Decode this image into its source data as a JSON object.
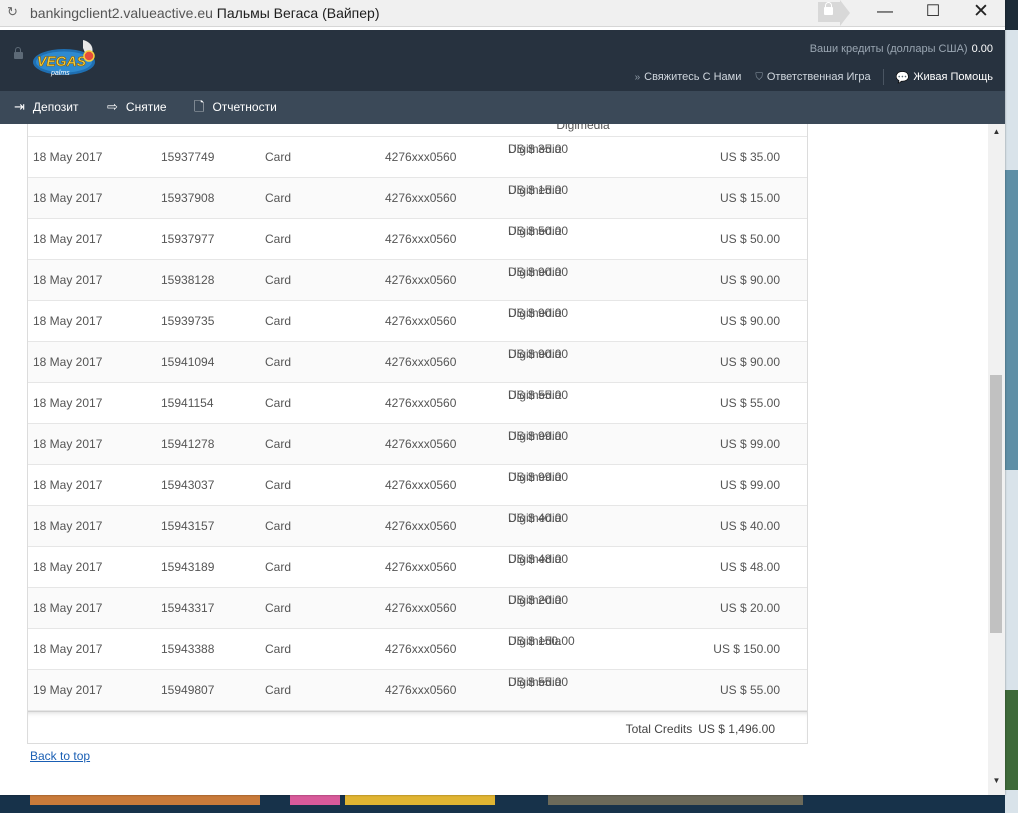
{
  "titlebar": {
    "url": "bankingclient2.valueactive.eu",
    "title": "Пальмы Вегаса (Вайпер)"
  },
  "header": {
    "credits_label": "Ваши кредиты (доллары США)",
    "credits_value": "0.00",
    "links": {
      "contact": "Свяжитесь С Нами",
      "responsible": "Ответственная Игра",
      "live_help": "Живая Помощь"
    }
  },
  "nav": {
    "deposit": "Депозит",
    "withdraw": "Снятие",
    "reports": "Отчетности"
  },
  "table": {
    "partial_row": {
      "method": "Digimedia"
    },
    "rows": [
      {
        "date": "18 May 2017",
        "id": "15937749",
        "type": "Card",
        "card": "4276xxx0560",
        "amount": "US $ 35.00",
        "method": "Digimedia",
        "credit": "US $ 35.00"
      },
      {
        "date": "18 May 2017",
        "id": "15937908",
        "type": "Card",
        "card": "4276xxx0560",
        "amount": "US $ 15.00",
        "method": "Digimedia",
        "credit": "US $ 15.00"
      },
      {
        "date": "18 May 2017",
        "id": "15937977",
        "type": "Card",
        "card": "4276xxx0560",
        "amount": "US $ 50.00",
        "method": "Digimedia",
        "credit": "US $ 50.00"
      },
      {
        "date": "18 May 2017",
        "id": "15938128",
        "type": "Card",
        "card": "4276xxx0560",
        "amount": "US $ 90.00",
        "method": "Digimedia",
        "credit": "US $ 90.00"
      },
      {
        "date": "18 May 2017",
        "id": "15939735",
        "type": "Card",
        "card": "4276xxx0560",
        "amount": "US $ 90.00",
        "method": "Digimedia",
        "credit": "US $ 90.00"
      },
      {
        "date": "18 May 2017",
        "id": "15941094",
        "type": "Card",
        "card": "4276xxx0560",
        "amount": "US $ 90.00",
        "method": "Digimedia",
        "credit": "US $ 90.00"
      },
      {
        "date": "18 May 2017",
        "id": "15941154",
        "type": "Card",
        "card": "4276xxx0560",
        "amount": "US $ 55.00",
        "method": "Digimedia",
        "credit": "US $ 55.00"
      },
      {
        "date": "18 May 2017",
        "id": "15941278",
        "type": "Card",
        "card": "4276xxx0560",
        "amount": "US $ 99.00",
        "method": "Digimedia",
        "credit": "US $ 99.00"
      },
      {
        "date": "18 May 2017",
        "id": "15943037",
        "type": "Card",
        "card": "4276xxx0560",
        "amount": "US $ 99.00",
        "method": "Digimedia",
        "credit": "US $ 99.00"
      },
      {
        "date": "18 May 2017",
        "id": "15943157",
        "type": "Card",
        "card": "4276xxx0560",
        "amount": "US $ 40.00",
        "method": "Digimedia",
        "credit": "US $ 40.00"
      },
      {
        "date": "18 May 2017",
        "id": "15943189",
        "type": "Card",
        "card": "4276xxx0560",
        "amount": "US $ 48.00",
        "method": "Digimedia",
        "credit": "US $ 48.00"
      },
      {
        "date": "18 May 2017",
        "id": "15943317",
        "type": "Card",
        "card": "4276xxx0560",
        "amount": "US $ 20.00",
        "method": "Digimedia",
        "credit": "US $ 20.00"
      },
      {
        "date": "18 May 2017",
        "id": "15943388",
        "type": "Card",
        "card": "4276xxx0560",
        "amount": "US $ 150.00",
        "method": "Digimedia",
        "credit": "US $ 150.00"
      },
      {
        "date": "19 May 2017",
        "id": "15949807",
        "type": "Card",
        "card": "4276xxx0560",
        "amount": "US $ 55.00",
        "method": "Digimedia",
        "credit": "US $ 55.00"
      }
    ],
    "total_label": "Total Credits",
    "total_value": "US $ 1,496.00"
  },
  "footer": {
    "back_to_top": "Back to top"
  },
  "colors": {
    "header_bg": "#27323f",
    "nav_bg": "#3b4958",
    "link": "#1a5fb4"
  }
}
